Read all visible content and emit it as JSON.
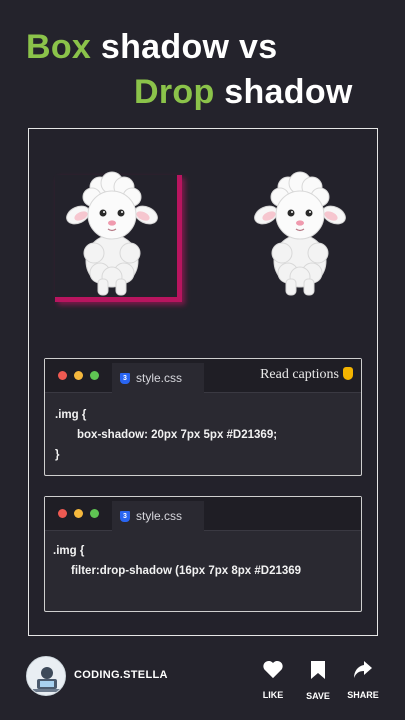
{
  "title": {
    "line1_green": "Box",
    "line1_rest": " shadow vs",
    "line2_green": "Drop",
    "line2_rest": " shadow"
  },
  "editor1": {
    "tab_label": "style.css",
    "caption": "Read captions",
    "code": [
      ".img {",
      "box-shadow: 20px 7px 5px #D21369;",
      "}"
    ]
  },
  "editor2": {
    "tab_label": "style.css",
    "code": [
      ".img {",
      "filter:drop-shadow (16px 7px 8px #D21369"
    ]
  },
  "footer": {
    "brand": "CODING.STELLA",
    "actions": [
      {
        "icon": "heart-icon",
        "label": "LIKE"
      },
      {
        "icon": "bookmark-icon",
        "label": "SAVE"
      },
      {
        "icon": "share-arrow-icon",
        "label": "SHARE"
      }
    ]
  },
  "colors": {
    "accent_green": "#8bc34a",
    "shadow_pink": "#D21369",
    "background": "#24232c"
  }
}
